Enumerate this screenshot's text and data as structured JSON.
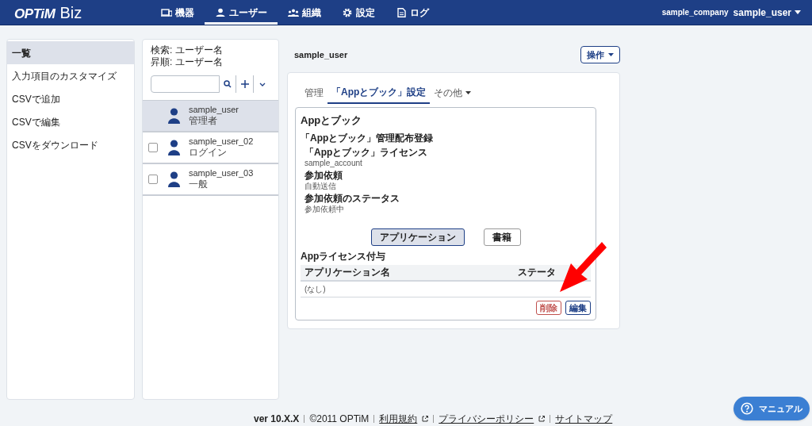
{
  "header": {
    "logo": "OPTiM",
    "logo_suffix": "Biz",
    "nav": [
      {
        "label": "機器",
        "selected": false
      },
      {
        "label": "ユーザー",
        "selected": true
      },
      {
        "label": "組織",
        "selected": false
      },
      {
        "label": "設定",
        "selected": false
      },
      {
        "label": "ログ",
        "selected": false
      }
    ],
    "company": "sample_company",
    "user": "sample_user"
  },
  "sidebar": {
    "items": [
      {
        "label": "一覧",
        "selected": true
      },
      {
        "label": "入力項目のカスタマイズ",
        "selected": false
      },
      {
        "label": "CSVで追加",
        "selected": false
      },
      {
        "label": "CSVで編集",
        "selected": false
      },
      {
        "label": "CSVをダウンロード",
        "selected": false
      }
    ]
  },
  "user_list": {
    "search_label": "検索: ユーザー名",
    "sort_label": "昇順: ユーザー名",
    "users": [
      {
        "name": "sample_user",
        "role": "管理者",
        "selected": true
      },
      {
        "name": "sample_user_02",
        "role": "ログイン",
        "selected": false,
        "checked": false
      },
      {
        "name": "sample_user_03",
        "role": "一般",
        "selected": false,
        "checked": false
      }
    ]
  },
  "detail": {
    "title": "sample_user",
    "action_button": "操作",
    "tabs": [
      {
        "label": "管理",
        "selected": false,
        "dropdown": false
      },
      {
        "label": "「Appとブック」設定",
        "selected": true,
        "dropdown": false
      },
      {
        "label": "その他",
        "selected": false,
        "dropdown": true
      }
    ],
    "section_title": "Appとブック",
    "subsection": "「Appとブック」管理配布登録",
    "fields": [
      {
        "label": "「Appとブック」ライセンス",
        "value": "sample_account"
      },
      {
        "label": "参加依頼",
        "value": "自動送信"
      },
      {
        "label": "参加依頼のステータス",
        "value": "参加依頼中"
      }
    ],
    "toggle_buttons": [
      {
        "label": "アプリケーション",
        "selected": true
      },
      {
        "label": "書籍",
        "selected": false
      }
    ],
    "license_title": "Appライセンス付与",
    "table": {
      "columns": [
        "アプリケーション名",
        "ステータ"
      ],
      "rows": [
        [
          "(なし)"
        ]
      ]
    },
    "buttons": [
      {
        "label": "削除",
        "kind": "danger"
      },
      {
        "label": "編集",
        "kind": "primary"
      }
    ]
  },
  "footer": {
    "version": "ver 10.X.X",
    "copyright": "©2011 OPTiM",
    "links": [
      {
        "label": "利用規約",
        "external": true
      },
      {
        "label": "プライバシーポリシー",
        "external": true
      },
      {
        "label": "サイトマップ",
        "external": false
      }
    ]
  },
  "manual_button": "マニュアル"
}
